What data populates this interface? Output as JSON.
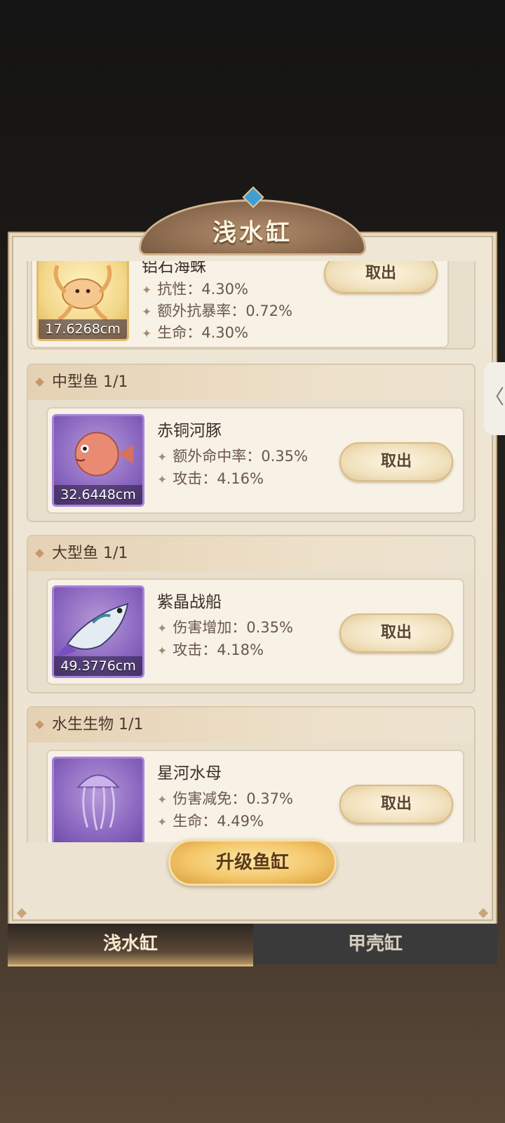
{
  "window": {
    "title": "浅水缸"
  },
  "groups": [
    {
      "header": "",
      "fish": {
        "name": "铝石海蛛",
        "size": "17.6268cm",
        "rarity": "gold",
        "stats": [
          "抗性：4.30%",
          "额外抗暴率：0.72%",
          "生命：4.30%"
        ],
        "action": "取出"
      }
    },
    {
      "header": "中型鱼 1/1",
      "fish": {
        "name": "赤铜河豚",
        "size": "32.6448cm",
        "rarity": "purple",
        "stats": [
          "额外命中率：0.35%",
          "攻击：4.16%"
        ],
        "action": "取出"
      }
    },
    {
      "header": "大型鱼 1/1",
      "fish": {
        "name": "紫晶战船",
        "size": "49.3776cm",
        "rarity": "purple",
        "stats": [
          "伤害增加：0.35%",
          "攻击：4.18%"
        ],
        "action": "取出"
      }
    },
    {
      "header": "水生生物 1/1",
      "fish": {
        "name": "星河水母",
        "size": "",
        "rarity": "purple",
        "stats": [
          "伤害减免：0.37%",
          "生命：4.49%"
        ],
        "action": "取出"
      }
    }
  ],
  "upgrade_button": "升级鱼缸",
  "tabs": [
    {
      "label": "浅水缸",
      "active": true
    },
    {
      "label": "甲壳缸",
      "active": false
    }
  ],
  "side_handle": "〈",
  "colors": {
    "panel_bg": "#ece3d2",
    "gold_frame": "#e2bd6d",
    "purple_frame": "#a982d8",
    "upgrade_gold": "#f3c76a"
  }
}
